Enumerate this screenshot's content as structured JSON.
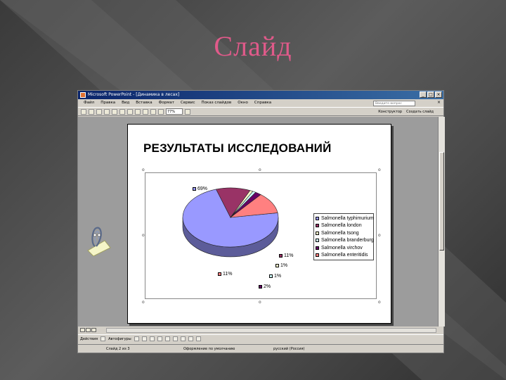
{
  "slide": {
    "title": "Слайд"
  },
  "window": {
    "title": "Microsoft PowerPoint - [Динамика в лесах]",
    "menu": [
      "Файл",
      "Правка",
      "Вид",
      "Вставка",
      "Формат",
      "Сервис",
      "Показ слайдов",
      "Окно",
      "Справка"
    ],
    "ask_placeholder": "Введите вопрос",
    "zoom": "77%",
    "toolbar_right": [
      "Конструктор",
      "Создать слайд"
    ],
    "draw_label": "Действия",
    "autoshapes_label": "Автофигуры",
    "status": {
      "slide": "Слайд 2 из 3",
      "design": "Оформление по умолчанию",
      "language": "русский (Россия)"
    }
  },
  "colors": {
    "slide_title": "#e05a8a",
    "titlebar": "#0a246a"
  },
  "icons": [
    "app-icon",
    "minimize-icon",
    "maximize-icon",
    "close-icon",
    "office-assistant-icon"
  ],
  "chart_data": {
    "type": "pie",
    "title": "РЕЗУЛЬТАТЫ ИССЛЕДОВАНИЙ",
    "legend_position": "right",
    "series": [
      {
        "name": "Salmonella typhimurium",
        "value": 69,
        "label": "69%",
        "color": "#9999ff"
      },
      {
        "name": "Salmonella london",
        "value": 11,
        "label": "11%",
        "color": "#993366"
      },
      {
        "name": "Salmonella tsong",
        "value": 1,
        "label": "1%",
        "color": "#ffffcc"
      },
      {
        "name": "Salmonella branderburg",
        "value": 1,
        "label": "1%",
        "color": "#ccffff"
      },
      {
        "name": "Salmonella virchov",
        "value": 2,
        "label": "2%",
        "color": "#660066"
      },
      {
        "name": "Salmonella enteritidis",
        "value": 11,
        "label": "11%",
        "color": "#ff8080"
      }
    ]
  }
}
